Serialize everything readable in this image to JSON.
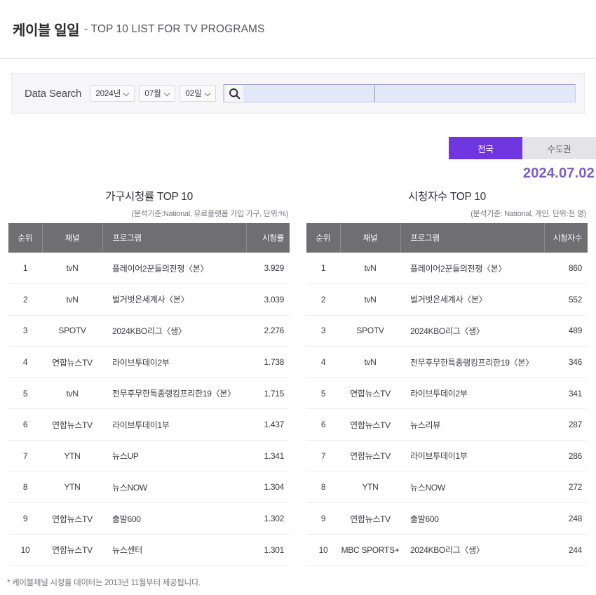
{
  "header": {
    "title_main": "케이블 일일",
    "title_sub": "- TOP 10 LIST FOR TV PROGRAMS"
  },
  "search": {
    "label": "Data Search",
    "year": "2024년",
    "month": "07월",
    "day": "02일",
    "search_icon": "search-icon",
    "keyword_value": "",
    "keyword_placeholder": "",
    "keyword2_value": "",
    "keyword2_placeholder": ""
  },
  "region_toggle": {
    "active": "전국",
    "inactive": "수도권"
  },
  "date_display": "2024.07.02",
  "colors": {
    "accent_purple": "#6f36e0",
    "value_purple": "#8264c6",
    "date_purple": "#7a5ccc",
    "header_gray": "#6e6e73",
    "panel_gray": "#f6f6f8",
    "input_blue": "#e2e8f8"
  },
  "tables": [
    {
      "title": "가구시청률 TOP 10",
      "subtitle": "(분석기준:National, 유료플랫폼 가입 가구, 단위:%)",
      "columns": [
        "순위",
        "채널",
        "프로그램",
        "시청률"
      ],
      "rows": [
        {
          "rank": "1",
          "channel": "tvN",
          "program": "플레이어2꾼들의전쟁〈본〉",
          "value": "3.929"
        },
        {
          "rank": "2",
          "channel": "tvN",
          "program": "벌거벗은세계사〈본〉",
          "value": "3.039"
        },
        {
          "rank": "3",
          "channel": "SPOTV",
          "program": "2024KBO리그〈생〉",
          "value": "2.276"
        },
        {
          "rank": "4",
          "channel": "연합뉴스TV",
          "program": "라이브투데이2부",
          "value": "1.738"
        },
        {
          "rank": "5",
          "channel": "tvN",
          "program": "전무후무한특종랭킹프리한19〈본〉",
          "value": "1.715"
        },
        {
          "rank": "6",
          "channel": "연합뉴스TV",
          "program": "라이브투데이1부",
          "value": "1.437"
        },
        {
          "rank": "7",
          "channel": "YTN",
          "program": "뉴스UP",
          "value": "1.341"
        },
        {
          "rank": "8",
          "channel": "YTN",
          "program": "뉴스NOW",
          "value": "1.304"
        },
        {
          "rank": "9",
          "channel": "연합뉴스TV",
          "program": "출발600",
          "value": "1.302"
        },
        {
          "rank": "10",
          "channel": "연합뉴스TV",
          "program": "뉴스센터",
          "value": "1.301"
        }
      ]
    },
    {
      "title": "시청자수 TOP 10",
      "subtitle": "(분석기준: National, 개인, 단위:천 명)",
      "columns": [
        "순위",
        "채널",
        "프로그램",
        "시청자수"
      ],
      "rows": [
        {
          "rank": "1",
          "channel": "tvN",
          "program": "플레이어2꾼들의전쟁〈본〉",
          "value": "860"
        },
        {
          "rank": "2",
          "channel": "tvN",
          "program": "벌거벗은세계사〈본〉",
          "value": "552"
        },
        {
          "rank": "3",
          "channel": "SPOTV",
          "program": "2024KBO리그〈생〉",
          "value": "489"
        },
        {
          "rank": "4",
          "channel": "tvN",
          "program": "전무후무한특종랭킹프리한19〈본〉",
          "value": "346"
        },
        {
          "rank": "5",
          "channel": "연합뉴스TV",
          "program": "라이브투데이2부",
          "value": "341"
        },
        {
          "rank": "6",
          "channel": "연합뉴스TV",
          "program": "뉴스리뷰",
          "value": "287"
        },
        {
          "rank": "7",
          "channel": "연합뉴스TV",
          "program": "라이브투데이1부",
          "value": "286"
        },
        {
          "rank": "8",
          "channel": "YTN",
          "program": "뉴스NOW",
          "value": "272"
        },
        {
          "rank": "9",
          "channel": "연합뉴스TV",
          "program": "출발600",
          "value": "248"
        },
        {
          "rank": "10",
          "channel": "MBC SPORTS+",
          "program": "2024KBO리그〈생〉",
          "value": "244"
        }
      ]
    }
  ],
  "footnote": "* 케이블채널 시청률 데이터는 2013년 11월부터 제공됩니다."
}
